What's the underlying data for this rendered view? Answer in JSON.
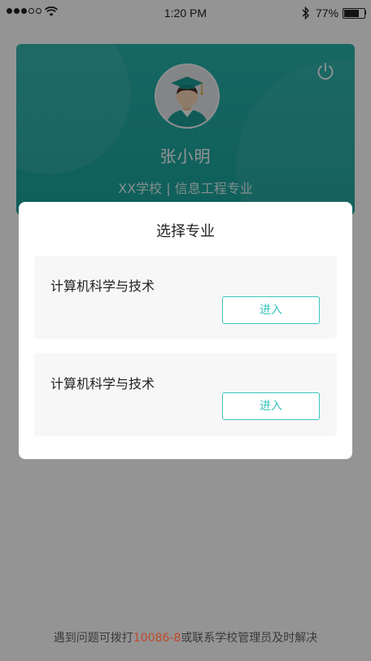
{
  "status_bar": {
    "time": "1:20 PM",
    "battery_pct": "77%",
    "battery_level": 0.77,
    "signal_icon": "signal-dots-icon",
    "wifi_icon": "wifi-icon",
    "bluetooth_icon": "bluetooth-icon"
  },
  "profile": {
    "name": "张小明",
    "school_major": "XX学校 | 信息工程专业",
    "avatar_icon": "graduate-avatar-icon",
    "power_icon": "power-icon",
    "accent_color": "#1aa39c"
  },
  "modal": {
    "title": "选择专业",
    "majors": [
      {
        "name": "计算机科学与技术",
        "button_label": "进入"
      },
      {
        "name": "计算机科学与技术",
        "button_label": "进入"
      }
    ],
    "button_color": "#3cc4bd"
  },
  "footer": {
    "prefix": "遇到问题可拨打",
    "phone": "10086-8",
    "suffix": "或联系学校管理员及时解决",
    "phone_color": "#c0492b"
  }
}
